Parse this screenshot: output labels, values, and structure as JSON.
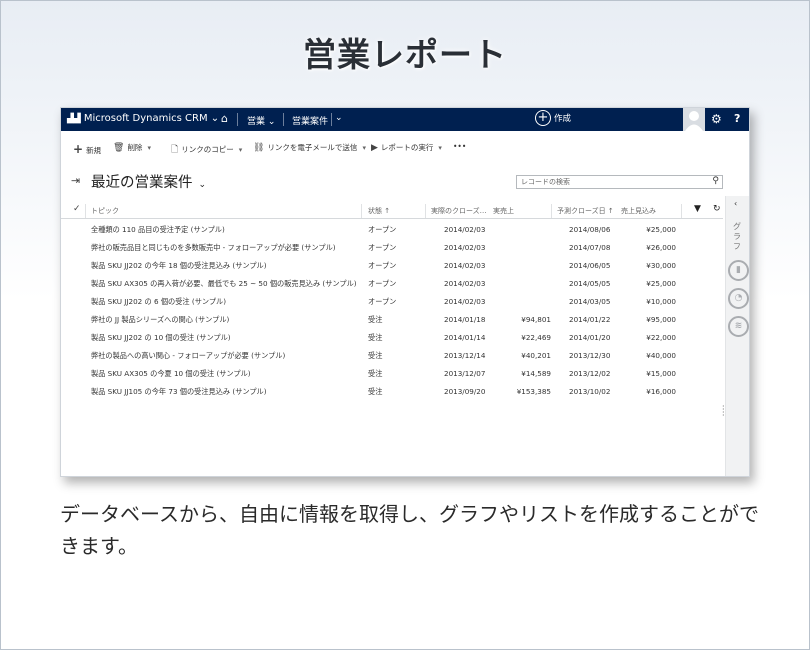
{
  "page": {
    "title": "営業レポート",
    "caption": "データベースから、自由に情報を取得し、グラフやリストを作成することができます。"
  },
  "navbar": {
    "brand": "Microsoft Dynamics CRM",
    "brand_chevron": "⌄",
    "home_icon": "⌂",
    "nav_sales": "営業 ⌄",
    "nav_opportunities": "営業案件",
    "nav_chevron": "⌄",
    "create_icon": "+",
    "create_label": "作成",
    "settings_icon": "⚙",
    "help": "?"
  },
  "commands": {
    "new": {
      "icon": "+",
      "label": "新規"
    },
    "delete": {
      "icon": "🗑",
      "label": "削除",
      "dropdown": "▾"
    },
    "copy_link": {
      "icon": "🗋",
      "label": "リンクのコピー",
      "dropdown": "▾"
    },
    "email_link": {
      "icon": "⛓",
      "label": "リンクを電子メールで送信",
      "dropdown": "▾"
    },
    "run_report": {
      "icon": "▶",
      "label": "レポートの実行",
      "dropdown": "▾"
    },
    "more": "•••"
  },
  "view": {
    "pin_icon": "⇥",
    "title": "最近の営業案件",
    "title_dropdown": "⌄",
    "search_placeholder": "レコードの検索",
    "search_icon": "⚲"
  },
  "grid": {
    "select_all_icon": "✓",
    "columns": {
      "topic": "トピック",
      "status": "状態 ↑",
      "actual_close": "実際のクローズ…",
      "actual_revenue": "実売上",
      "est_close": "予測クローズ日 ↑",
      "est_revenue": "売上見込み"
    },
    "filter_icon": "▼",
    "refresh_icon": "↻",
    "rows": [
      {
        "topic": "全種類の 110 品目の受注予定 (サンプル)",
        "status": "オープン",
        "actual_close": "2014/02/03",
        "actual_revenue": "",
        "est_close": "2014/08/06",
        "est_revenue": "¥25,000"
      },
      {
        "topic": "弊社の販売品目と同じものを多数販売中 - フォローアップが必要 (サンプル)",
        "status": "オープン",
        "actual_close": "2014/02/03",
        "actual_revenue": "",
        "est_close": "2014/07/08",
        "est_revenue": "¥26,000"
      },
      {
        "topic": "製品 SKU JJ202 の今年 18 個の受注見込み (サンプル)",
        "status": "オープン",
        "actual_close": "2014/02/03",
        "actual_revenue": "",
        "est_close": "2014/06/05",
        "est_revenue": "¥30,000"
      },
      {
        "topic": "製品 SKU AX305 の再入荷が必要、最低でも 25 ~ 50 個の販売見込み (サンプル)",
        "status": "オープン",
        "actual_close": "2014/02/03",
        "actual_revenue": "",
        "est_close": "2014/05/05",
        "est_revenue": "¥25,000"
      },
      {
        "topic": "製品 SKU JJ202 の 6 個の受注 (サンプル)",
        "status": "オープン",
        "actual_close": "2014/02/03",
        "actual_revenue": "",
        "est_close": "2014/03/05",
        "est_revenue": "¥10,000"
      },
      {
        "topic": "弊社の JJ 製品シリーズへの関心 (サンプル)",
        "status": "受注",
        "actual_close": "2014/01/18",
        "actual_revenue": "¥94,801",
        "est_close": "2014/01/22",
        "est_revenue": "¥95,000"
      },
      {
        "topic": "製品 SKU JJ202 の 10 個の受注 (サンプル)",
        "status": "受注",
        "actual_close": "2014/01/14",
        "actual_revenue": "¥22,469",
        "est_close": "2014/01/20",
        "est_revenue": "¥22,000"
      },
      {
        "topic": "弊社の製品への高い関心 - フォローアップが必要 (サンプル)",
        "status": "受注",
        "actual_close": "2013/12/14",
        "actual_revenue": "¥40,201",
        "est_close": "2013/12/30",
        "est_revenue": "¥40,000"
      },
      {
        "topic": "製品 SKU AX305 の今夏 10 個の受注 (サンプル)",
        "status": "受注",
        "actual_close": "2013/12/07",
        "actual_revenue": "¥14,589",
        "est_close": "2013/12/02",
        "est_revenue": "¥15,000"
      },
      {
        "topic": "製品 SKU JJ105 の今年 73 個の受注見込み (サンプル)",
        "status": "受注",
        "actual_close": "2013/09/20",
        "actual_revenue": "¥153,385",
        "est_close": "2013/10/02",
        "est_revenue": "¥16,000"
      }
    ]
  },
  "side_panel": {
    "collapse_icon": "‹",
    "label": "グラフ",
    "icons": [
      "bar-chart-icon",
      "pie-chart-icon",
      "funnel-chart-icon"
    ],
    "icon_glyphs": [
      "▮",
      "◔",
      "≋"
    ]
  }
}
